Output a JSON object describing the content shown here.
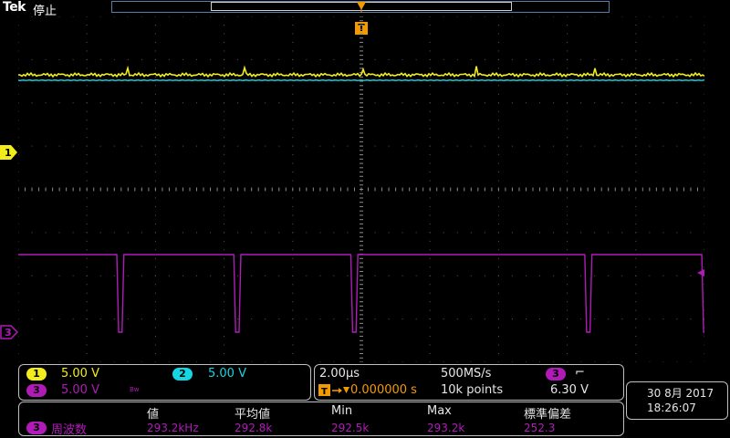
{
  "header": {
    "brand": "Tek",
    "status": "停止"
  },
  "trigger_marker_label": "T",
  "channel_markers": {
    "ch1": "1",
    "ch3": "3"
  },
  "channels": [
    {
      "id": "1",
      "scale": "5.00 V",
      "color": "#f2ec1a"
    },
    {
      "id": "2",
      "scale": "5.00 V",
      "color": "#14d7e4"
    },
    {
      "id": "3",
      "scale": "5.00 V",
      "color": "#b01bb8",
      "bw_symbol": "Bw"
    }
  ],
  "timebase": {
    "scale": "2.00µs",
    "sample_rate": "500MS/s",
    "trigger_delay": "0.000000 s",
    "record_length": "10k points",
    "trigger_source": "3",
    "trigger_slope_symbol": "⌐",
    "trigger_level": "6.30 V"
  },
  "measurements": {
    "headers": [
      "値",
      "平均値",
      "Min",
      "Max",
      "標準偏差"
    ],
    "source": "3",
    "name": "周波数",
    "values": [
      "293.2kHz",
      "292.8k",
      "292.5k",
      "293.2k",
      "252.3"
    ]
  },
  "datetime": {
    "date": "30 8月 2017",
    "time": "18:26:07"
  },
  "colors": {
    "ch1": "#f2ec1a",
    "ch2": "#14d7e4",
    "ch3": "#b01bb8",
    "trigger": "#f39a00",
    "grid": "#5a5a5a"
  },
  "waveform": {
    "ch3_pulse_period_us": 3.41,
    "ch3_pulse_width_us": 0.1
  }
}
